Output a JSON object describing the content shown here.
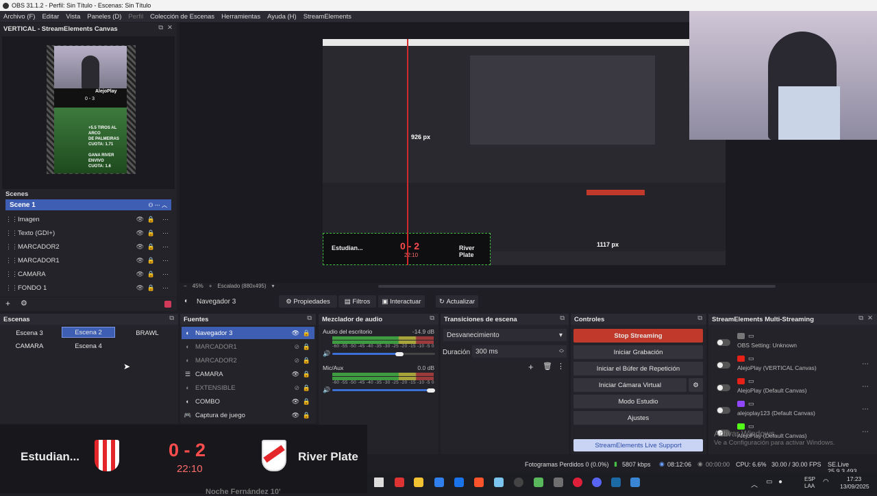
{
  "window": {
    "title": "OBS 31.1.2 - Perfil: Sin Título - Escenas: Sin Título"
  },
  "menu": [
    "Archivo (F)",
    "Editar",
    "Vista",
    "Paneles (D)",
    "Perfil",
    "Colección de Escenas",
    "Herramientas",
    "Ayuda (H)",
    "StreamElements"
  ],
  "vertical": {
    "title": "VERTICAL - StreamElements Canvas"
  },
  "vertical_scenes": {
    "header": "Scenes",
    "selected": "Scene 1"
  },
  "vertical_sources": [
    "Imagen",
    "Texto (GDI+)",
    "MARCADOR2",
    "MARCADOR1",
    "CAMARA",
    "FONDO 1"
  ],
  "preview": {
    "width_label": "926 px",
    "height_label": "1117 px",
    "zoom": "45%",
    "scaled": "Escalado (880x495)"
  },
  "source_toolbar": {
    "source_name": "Navegador 3",
    "properties": "Propiedades",
    "filters": "Filtros",
    "interact": "Interactuar",
    "refresh": "Actualizar"
  },
  "scenes": {
    "header": "Escenas",
    "items": [
      "Escena 3",
      "Escena 2",
      "BRAWL",
      "CAMARA",
      "Escena 4"
    ],
    "selected": "Escena 2"
  },
  "sources": {
    "header": "Fuentes",
    "items": [
      "Navegador 3",
      "MARCADOR1",
      "MARCADOR2",
      "CAMARA",
      "EXTENSIBLE",
      "COMBO",
      "Captura de juego"
    ]
  },
  "mixer": {
    "header": "Mezclador de audio",
    "desktop_label": "Audio del escritorio",
    "desktop_db": "-14.9 dB",
    "mic_label": "Mic/Aux",
    "mic_db": "0.0 dB",
    "scale": "-60 -55 -50 -45 -40 -35 -30 -25 -20 -15 -10 -5 0",
    "desktop_volume": 0.65,
    "mic_volume": 1.0
  },
  "transitions": {
    "header": "Transiciones de escena",
    "transition": "Desvanecimiento",
    "duration_label": "Duración",
    "duration_value": "300 ms"
  },
  "controls": {
    "header": "Controles",
    "stop_streaming": "Stop Streaming",
    "start_recording": "Iniciar Grabación",
    "replay_buffer": "Iniciar el Búfer de Repetición",
    "virtual_cam": "Iniciar Cámara Virtual",
    "studio_mode": "Modo Estudio",
    "settings": "Ajustes",
    "support": "StreamElements Live Support"
  },
  "multistream": {
    "header": "StreamElements Multi-Streaming",
    "items": [
      {
        "label": "OBS Setting: Unknown"
      },
      {
        "label": "AlejoPlay (VERTICAL Canvas)"
      },
      {
        "label": "AlejoPlay (Default Canvas)"
      },
      {
        "label": "alejoplay123 (Default Canvas)"
      },
      {
        "label": "AlejoPlay (Default Canvas)"
      }
    ]
  },
  "activate": {
    "line1": "Activar Windows",
    "line2": "Ve a Configuración para activar Windows."
  },
  "status": {
    "dropped": "Fotogramas Perdidos 0 (0.0%)",
    "kbps": "5807 kbps",
    "stream_time": "08:12:06",
    "rec_time": "00:00:00",
    "cpu": "CPU: 6.6%",
    "fps": "30.00 / 30.00 FPS",
    "version": "SE.Live 25.9.3.493"
  },
  "scoreboard": {
    "home": "Estudian...",
    "score": "0 - 2",
    "time": "22:10",
    "away": "River Plate",
    "bottom_text": "Noche Fernández 10'"
  },
  "vertical_overlay": {
    "channel": "AlejoPlay",
    "promo_line1": "+5.5 TIROS AL ARCO",
    "promo_line2": "DE PALMEIRAS",
    "promo_line3": "CUOTA: 1.71",
    "promo_line4": "GANA RIVER ENVIVO",
    "promo_line5": "CUOTA: 1.6",
    "mini_score": "0 - 3"
  },
  "tray": {
    "lang": "ESP",
    "lang2": "LAA",
    "time": "17:23",
    "date": "13/09/2025"
  },
  "colors": {
    "accent": "#3e5eb3",
    "stop": "#c0392b",
    "river_red": "#e4262b",
    "score_red": "#ff4d4d"
  }
}
